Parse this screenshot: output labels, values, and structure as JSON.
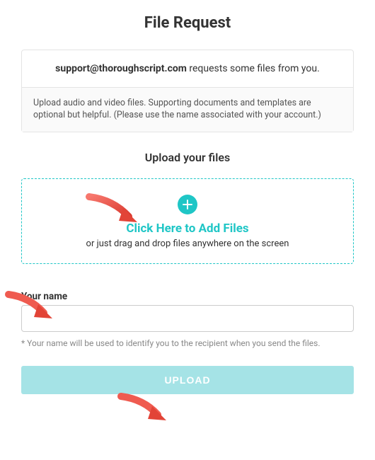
{
  "title": "File Request",
  "request": {
    "emailBold": "support@thoroughscript.com",
    "afterEmail": " requests some files from you.",
    "instructions": "Upload audio and video files. Supporting documents and templates are optional but helpful. (Please use the name associated with your account.)"
  },
  "uploadSection": {
    "heading": "Upload your files",
    "addFiles": "Click Here to Add Files",
    "dragText": "or just drag and drop files anywhere on the screen"
  },
  "nameSection": {
    "label": "Your name",
    "placeholder": "",
    "hint": "* Your name will be used to identify you to the recipient when you send the files."
  },
  "buttons": {
    "upload": "UPLOAD"
  },
  "colors": {
    "accent": "#1fc6c6",
    "buttonBg": "#a5e3e6",
    "arrow": "#f05a4f"
  }
}
